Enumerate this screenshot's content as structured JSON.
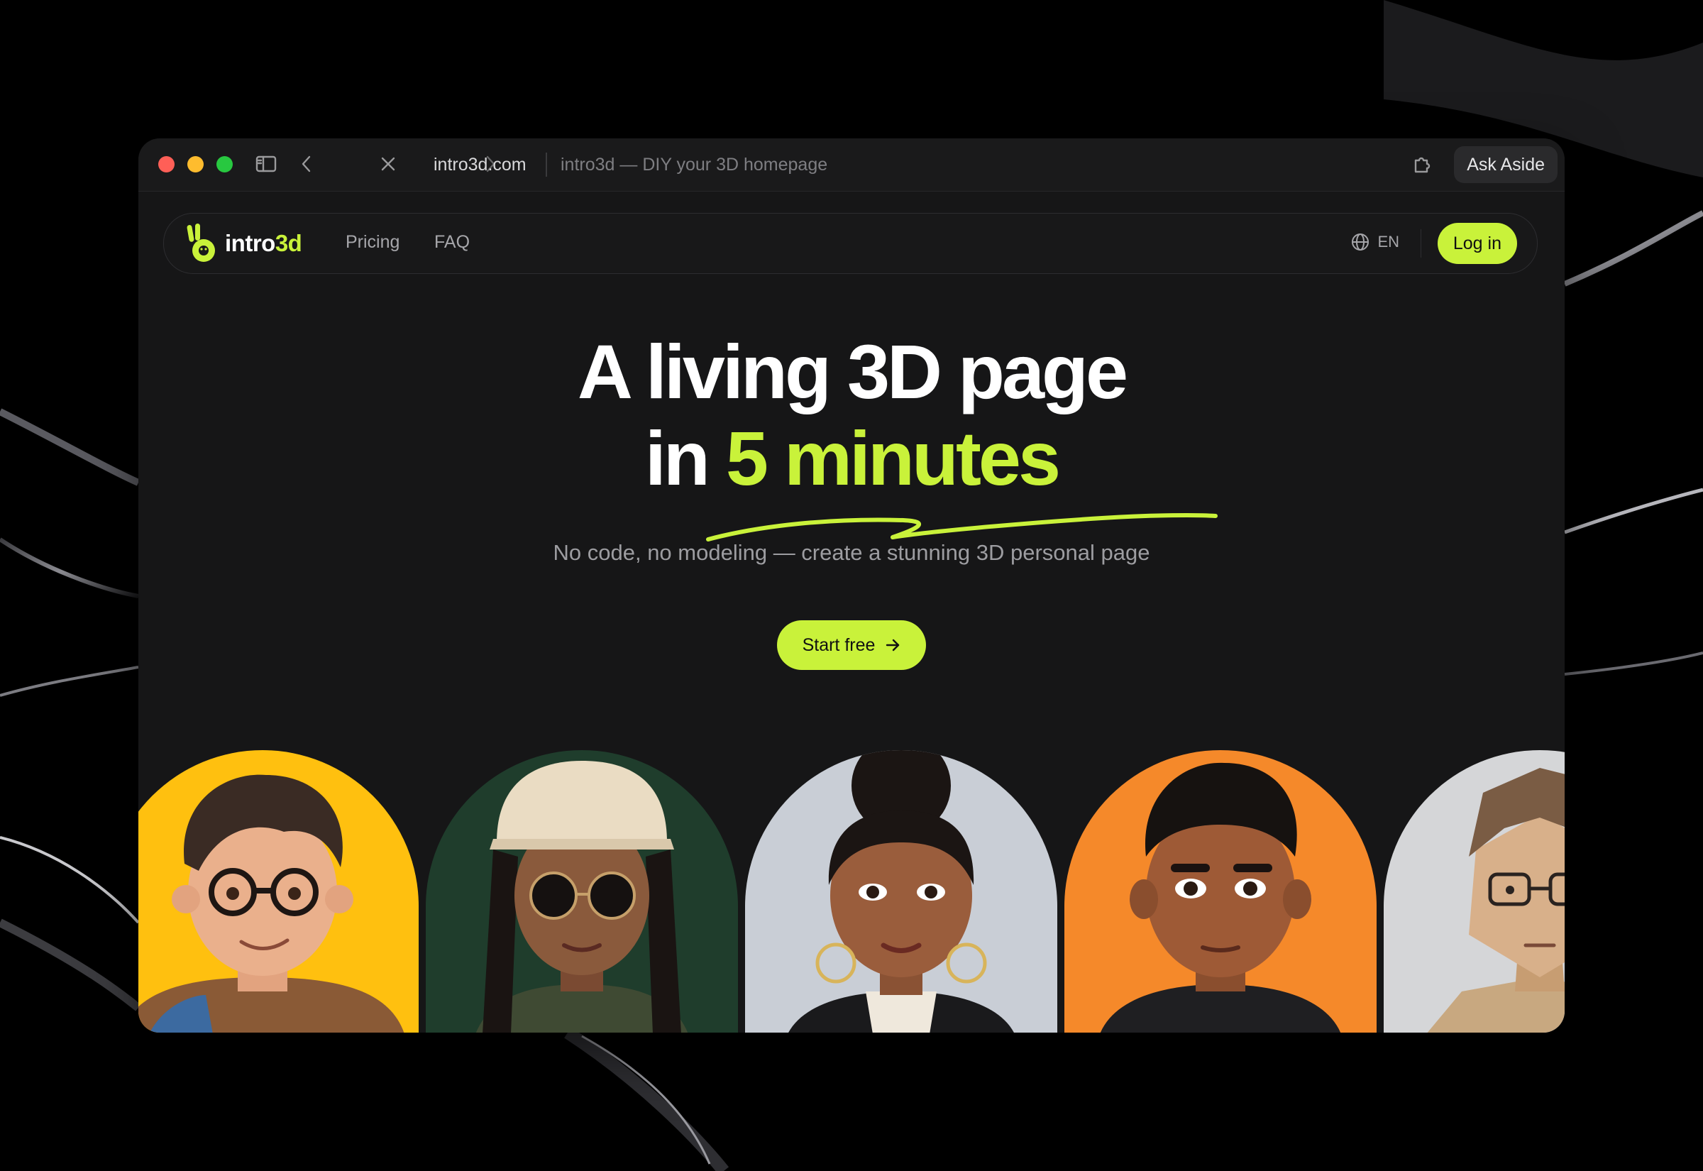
{
  "colors": {
    "accent": "#c9f23a",
    "page_bg": "#161617",
    "traffic_red": "#ff5f57",
    "traffic_yellow": "#febc2e",
    "traffic_green": "#28c840"
  },
  "browser": {
    "url_host": "intro3d.com",
    "page_title": "intro3d — DIY your 3D homepage",
    "ask_button": "Ask Aside",
    "icons": [
      "sidebar-icon",
      "back-icon",
      "forward-icon",
      "close-icon",
      "extension-icon"
    ]
  },
  "nav": {
    "logo_main": "intro",
    "logo_accent": "3d",
    "links": [
      "Pricing",
      "FAQ"
    ],
    "language": "EN",
    "login": "Log in"
  },
  "hero": {
    "line1": "A living 3D page",
    "line2_prefix": "in",
    "line2_accent": "5 minutes",
    "subtitle": "No code, no modeling — create a stunning 3D personal page",
    "cta": "Start free"
  },
  "avatars": [
    {
      "name": "curly-hair-glasses-avatar",
      "bg": "#ffc00f"
    },
    {
      "name": "cap-sunglasses-avatar",
      "bg": "#1f3d2c"
    },
    {
      "name": "bun-hoop-earrings-avatar",
      "bg": "#c9ced6"
    },
    {
      "name": "short-hair-avatar",
      "bg": "#f5892a"
    },
    {
      "name": "lowpoly-glasses-avatar",
      "bg": "#d5d6d8"
    }
  ]
}
